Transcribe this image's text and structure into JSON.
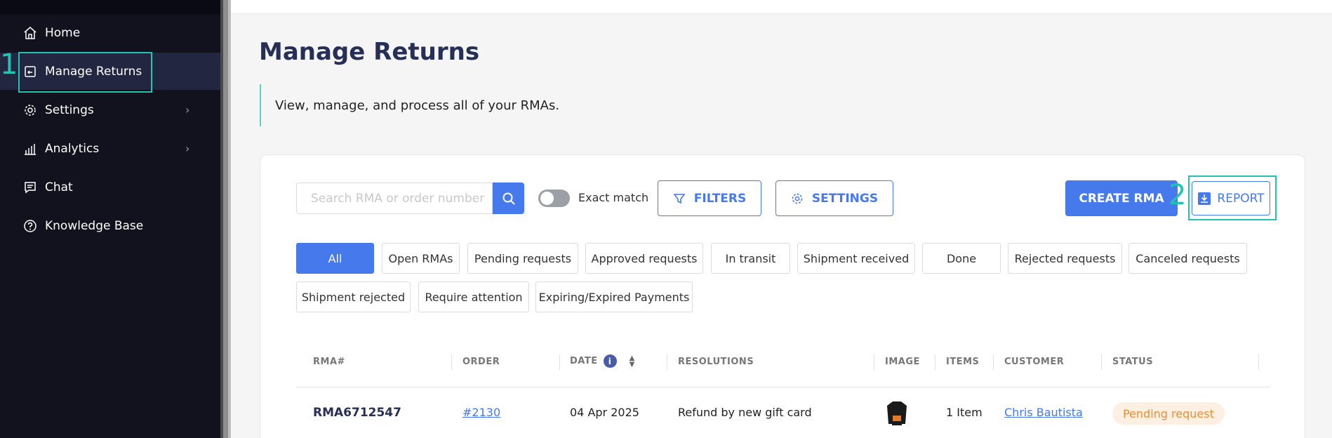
{
  "sidebar": {
    "items": [
      {
        "label": "Home",
        "icon": "home-icon"
      },
      {
        "label": "Manage Returns",
        "icon": "returns-icon"
      },
      {
        "label": "Settings",
        "icon": "gear-icon"
      },
      {
        "label": "Analytics",
        "icon": "bar-chart-icon"
      },
      {
        "label": "Chat",
        "icon": "chat-icon"
      },
      {
        "label": "Knowledge Base",
        "icon": "help-circle-icon"
      }
    ],
    "active_index": 1
  },
  "annotations": [
    "1",
    "2"
  ],
  "page": {
    "title": "Manage Returns",
    "description": "View, manage, and process all of your RMAs."
  },
  "toolbar": {
    "search_placeholder": "Search RMA or order number",
    "exact_match_label": "Exact match",
    "exact_match_on": false,
    "filters_label": "FILTERS",
    "settings_label": "SETTINGS",
    "create_label": "CREATE RMA",
    "report_label": "REPORT"
  },
  "chips": [
    "All",
    "Open RMAs",
    "Pending requests",
    "Approved requests",
    "In transit",
    "Shipment received",
    "Done",
    "Rejected requests",
    "Canceled requests",
    "Shipment rejected",
    "Require attention",
    "Expiring/Expired Payments"
  ],
  "table": {
    "columns": [
      "RMA#",
      "ORDER",
      "DATE",
      "RESOLUTIONS",
      "IMAGE",
      "ITEMS",
      "CUSTOMER",
      "STATUS"
    ],
    "rows": [
      {
        "rma": "RMA6712547",
        "order": "#2130",
        "date": "04 Apr 2025",
        "resolution": "Refund by new gift card",
        "items": "1 Item",
        "customer": "Chris Bautista",
        "status": "Pending request"
      }
    ]
  },
  "colors": {
    "accent": "#4579ec",
    "sidebar_bg": "#12121f",
    "title": "#263056",
    "annotation": "#22c3b3",
    "status_pending_bg": "#fdf0e2",
    "status_pending_text": "#f08c2e"
  }
}
